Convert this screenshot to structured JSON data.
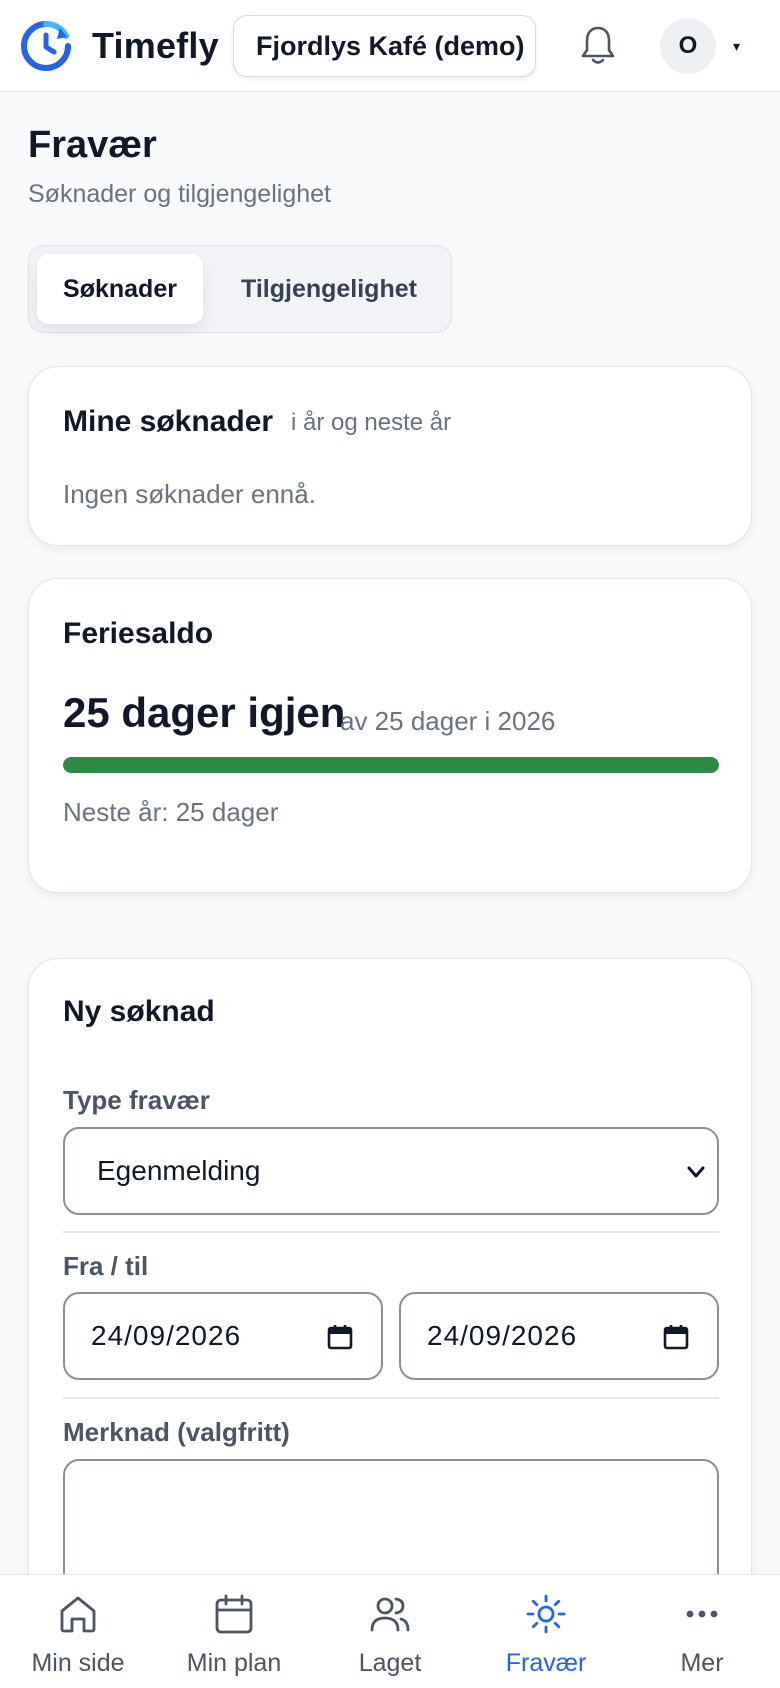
{
  "header": {
    "brand": "Timefly",
    "org": "Fjordlys Kafé (demo)",
    "avatar_initial": "O",
    "avatar_caret": "▾"
  },
  "page": {
    "title": "Fravær",
    "subtitle": "Søknader og tilgjengelighet"
  },
  "tabs": [
    {
      "label": "Søknader",
      "active": true
    },
    {
      "label": "Tilgjengelighet",
      "active": false
    }
  ],
  "applications": {
    "title": "Mine søknader",
    "scope": "i år og neste år",
    "empty": "Ingen søknader ennå."
  },
  "balance": {
    "title": "Feriesaldo",
    "remaining": "25 dager igjen",
    "of_total": "av 25 dager i 2026",
    "progress_fraction": 1.0,
    "next_year": "Neste år: 25 dager"
  },
  "new_request": {
    "title": "Ny søknad",
    "type_label": "Type fravær",
    "type_value": "Egenmelding",
    "range_label": "Fra / til",
    "from_date": "24/09/2026",
    "to_date": "24/09/2026",
    "note_label": "Merknad (valgfritt)"
  },
  "nav": [
    {
      "label": "Min side",
      "icon": "home-icon",
      "active": false
    },
    {
      "label": "Min plan",
      "icon": "calendar-icon",
      "active": false
    },
    {
      "label": "Laget",
      "icon": "users-icon",
      "active": false
    },
    {
      "label": "Fravær",
      "icon": "sun-icon",
      "active": true
    },
    {
      "label": "Mer",
      "icon": "more-icon",
      "active": false
    }
  ],
  "colors": {
    "accent": "#2563eb",
    "progress": "#2f8a45",
    "text": "#111827",
    "muted": "#6b7280"
  }
}
